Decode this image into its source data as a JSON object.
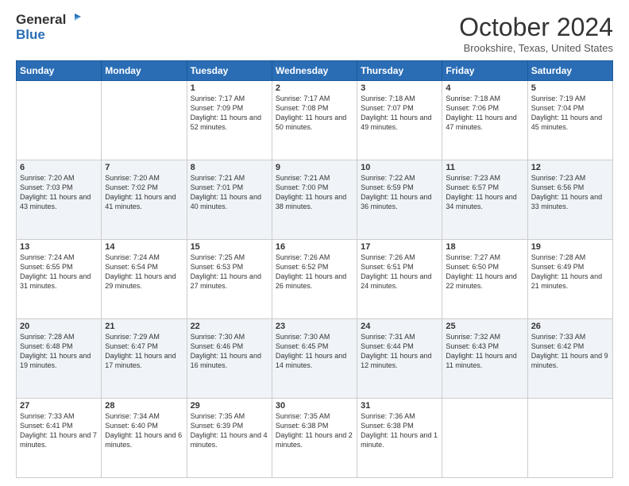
{
  "header": {
    "logo_general": "General",
    "logo_blue": "Blue",
    "month_title": "October 2024",
    "location": "Brookshire, Texas, United States"
  },
  "days_of_week": [
    "Sunday",
    "Monday",
    "Tuesday",
    "Wednesday",
    "Thursday",
    "Friday",
    "Saturday"
  ],
  "weeks": [
    [
      {
        "day": "",
        "sunrise": "",
        "sunset": "",
        "daylight": ""
      },
      {
        "day": "",
        "sunrise": "",
        "sunset": "",
        "daylight": ""
      },
      {
        "day": "1",
        "sunrise": "Sunrise: 7:17 AM",
        "sunset": "Sunset: 7:09 PM",
        "daylight": "Daylight: 11 hours and 52 minutes."
      },
      {
        "day": "2",
        "sunrise": "Sunrise: 7:17 AM",
        "sunset": "Sunset: 7:08 PM",
        "daylight": "Daylight: 11 hours and 50 minutes."
      },
      {
        "day": "3",
        "sunrise": "Sunrise: 7:18 AM",
        "sunset": "Sunset: 7:07 PM",
        "daylight": "Daylight: 11 hours and 49 minutes."
      },
      {
        "day": "4",
        "sunrise": "Sunrise: 7:18 AM",
        "sunset": "Sunset: 7:06 PM",
        "daylight": "Daylight: 11 hours and 47 minutes."
      },
      {
        "day": "5",
        "sunrise": "Sunrise: 7:19 AM",
        "sunset": "Sunset: 7:04 PM",
        "daylight": "Daylight: 11 hours and 45 minutes."
      }
    ],
    [
      {
        "day": "6",
        "sunrise": "Sunrise: 7:20 AM",
        "sunset": "Sunset: 7:03 PM",
        "daylight": "Daylight: 11 hours and 43 minutes."
      },
      {
        "day": "7",
        "sunrise": "Sunrise: 7:20 AM",
        "sunset": "Sunset: 7:02 PM",
        "daylight": "Daylight: 11 hours and 41 minutes."
      },
      {
        "day": "8",
        "sunrise": "Sunrise: 7:21 AM",
        "sunset": "Sunset: 7:01 PM",
        "daylight": "Daylight: 11 hours and 40 minutes."
      },
      {
        "day": "9",
        "sunrise": "Sunrise: 7:21 AM",
        "sunset": "Sunset: 7:00 PM",
        "daylight": "Daylight: 11 hours and 38 minutes."
      },
      {
        "day": "10",
        "sunrise": "Sunrise: 7:22 AM",
        "sunset": "Sunset: 6:59 PM",
        "daylight": "Daylight: 11 hours and 36 minutes."
      },
      {
        "day": "11",
        "sunrise": "Sunrise: 7:23 AM",
        "sunset": "Sunset: 6:57 PM",
        "daylight": "Daylight: 11 hours and 34 minutes."
      },
      {
        "day": "12",
        "sunrise": "Sunrise: 7:23 AM",
        "sunset": "Sunset: 6:56 PM",
        "daylight": "Daylight: 11 hours and 33 minutes."
      }
    ],
    [
      {
        "day": "13",
        "sunrise": "Sunrise: 7:24 AM",
        "sunset": "Sunset: 6:55 PM",
        "daylight": "Daylight: 11 hours and 31 minutes."
      },
      {
        "day": "14",
        "sunrise": "Sunrise: 7:24 AM",
        "sunset": "Sunset: 6:54 PM",
        "daylight": "Daylight: 11 hours and 29 minutes."
      },
      {
        "day": "15",
        "sunrise": "Sunrise: 7:25 AM",
        "sunset": "Sunset: 6:53 PM",
        "daylight": "Daylight: 11 hours and 27 minutes."
      },
      {
        "day": "16",
        "sunrise": "Sunrise: 7:26 AM",
        "sunset": "Sunset: 6:52 PM",
        "daylight": "Daylight: 11 hours and 26 minutes."
      },
      {
        "day": "17",
        "sunrise": "Sunrise: 7:26 AM",
        "sunset": "Sunset: 6:51 PM",
        "daylight": "Daylight: 11 hours and 24 minutes."
      },
      {
        "day": "18",
        "sunrise": "Sunrise: 7:27 AM",
        "sunset": "Sunset: 6:50 PM",
        "daylight": "Daylight: 11 hours and 22 minutes."
      },
      {
        "day": "19",
        "sunrise": "Sunrise: 7:28 AM",
        "sunset": "Sunset: 6:49 PM",
        "daylight": "Daylight: 11 hours and 21 minutes."
      }
    ],
    [
      {
        "day": "20",
        "sunrise": "Sunrise: 7:28 AM",
        "sunset": "Sunset: 6:48 PM",
        "daylight": "Daylight: 11 hours and 19 minutes."
      },
      {
        "day": "21",
        "sunrise": "Sunrise: 7:29 AM",
        "sunset": "Sunset: 6:47 PM",
        "daylight": "Daylight: 11 hours and 17 minutes."
      },
      {
        "day": "22",
        "sunrise": "Sunrise: 7:30 AM",
        "sunset": "Sunset: 6:46 PM",
        "daylight": "Daylight: 11 hours and 16 minutes."
      },
      {
        "day": "23",
        "sunrise": "Sunrise: 7:30 AM",
        "sunset": "Sunset: 6:45 PM",
        "daylight": "Daylight: 11 hours and 14 minutes."
      },
      {
        "day": "24",
        "sunrise": "Sunrise: 7:31 AM",
        "sunset": "Sunset: 6:44 PM",
        "daylight": "Daylight: 11 hours and 12 minutes."
      },
      {
        "day": "25",
        "sunrise": "Sunrise: 7:32 AM",
        "sunset": "Sunset: 6:43 PM",
        "daylight": "Daylight: 11 hours and 11 minutes."
      },
      {
        "day": "26",
        "sunrise": "Sunrise: 7:33 AM",
        "sunset": "Sunset: 6:42 PM",
        "daylight": "Daylight: 11 hours and 9 minutes."
      }
    ],
    [
      {
        "day": "27",
        "sunrise": "Sunrise: 7:33 AM",
        "sunset": "Sunset: 6:41 PM",
        "daylight": "Daylight: 11 hours and 7 minutes."
      },
      {
        "day": "28",
        "sunrise": "Sunrise: 7:34 AM",
        "sunset": "Sunset: 6:40 PM",
        "daylight": "Daylight: 11 hours and 6 minutes."
      },
      {
        "day": "29",
        "sunrise": "Sunrise: 7:35 AM",
        "sunset": "Sunset: 6:39 PM",
        "daylight": "Daylight: 11 hours and 4 minutes."
      },
      {
        "day": "30",
        "sunrise": "Sunrise: 7:35 AM",
        "sunset": "Sunset: 6:38 PM",
        "daylight": "Daylight: 11 hours and 2 minutes."
      },
      {
        "day": "31",
        "sunrise": "Sunrise: 7:36 AM",
        "sunset": "Sunset: 6:38 PM",
        "daylight": "Daylight: 11 hours and 1 minute."
      },
      {
        "day": "",
        "sunrise": "",
        "sunset": "",
        "daylight": ""
      },
      {
        "day": "",
        "sunrise": "",
        "sunset": "",
        "daylight": ""
      }
    ]
  ]
}
